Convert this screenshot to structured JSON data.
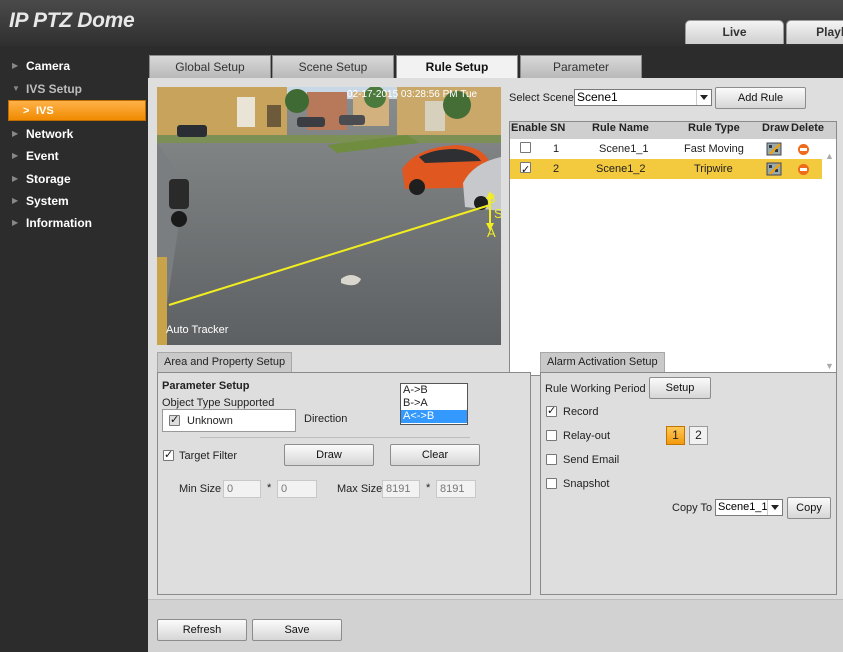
{
  "app": {
    "title": "IP PTZ Dome"
  },
  "top_tabs": [
    {
      "label": "Live"
    },
    {
      "label": "Playba"
    }
  ],
  "sidebar": {
    "items": [
      {
        "label": "Camera"
      },
      {
        "label": "IVS Setup"
      },
      {
        "label": "IVS"
      },
      {
        "label": "Network"
      },
      {
        "label": "Event"
      },
      {
        "label": "Storage"
      },
      {
        "label": "System"
      },
      {
        "label": "Information"
      }
    ]
  },
  "sub_tabs": [
    {
      "label": "Global Setup"
    },
    {
      "label": "Scene Setup"
    },
    {
      "label": "Rule Setup"
    },
    {
      "label": "Parameter"
    }
  ],
  "video": {
    "timestamp": "02-17-2015 03:28:56 PM Tue",
    "overlay_label": "Auto Tracker",
    "tripwire_labels": [
      "B",
      "S",
      "A"
    ]
  },
  "scene": {
    "label": "Select Scene",
    "value": "Scene1",
    "add_rule": "Add Rule"
  },
  "rule_table": {
    "headers": [
      "Enable",
      "SN",
      "Rule Name",
      "Rule Type",
      "Draw",
      "Delete"
    ],
    "rows": [
      {
        "enabled": false,
        "sn": "1",
        "name": "Scene1_1",
        "type": "Fast Moving",
        "selected": false
      },
      {
        "enabled": true,
        "sn": "2",
        "name": "Scene1_2",
        "type": "Tripwire",
        "selected": true
      }
    ]
  },
  "area": {
    "tab": "Area and Property Setup",
    "parameter_setup": "Parameter Setup",
    "object_type": "Object Type Supported",
    "unknown": "Unknown",
    "unknown_checked": true,
    "direction_label": "Direction",
    "direction_options": [
      "A->B",
      "B->A",
      "A<->B"
    ],
    "direction_selected": "A<->B",
    "target_filter": "Target Filter",
    "target_filter_checked": true,
    "draw": "Draw",
    "clear": "Clear",
    "min_size_label": "Min Size",
    "min_w": "0",
    "min_h": "0",
    "max_size_label": "Max Size",
    "max_w": "8191",
    "max_h": "8191",
    "times": "*"
  },
  "alarm": {
    "tab": "Alarm Activation Setup",
    "working_period": "Rule Working Period",
    "setup": "Setup",
    "record": "Record",
    "record_checked": true,
    "relay_out": "Relay-out",
    "relay_out_checked": false,
    "relay_channels": [
      "1",
      "2"
    ],
    "send_email": "Send Email",
    "snapshot": "Snapshot",
    "copy_to_label": "Copy To",
    "copy_to_value": "Scene1_1",
    "copy": "Copy"
  },
  "footer": {
    "refresh": "Refresh",
    "save": "Save"
  }
}
